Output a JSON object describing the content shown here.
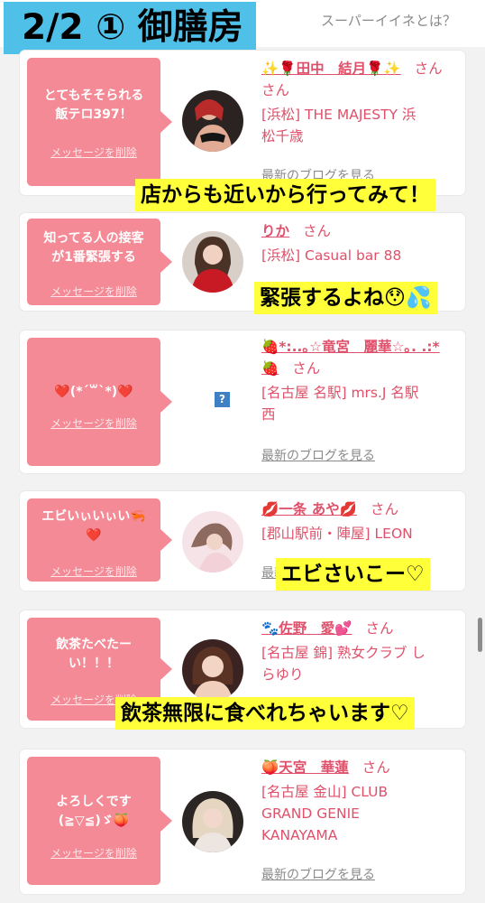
{
  "header": {
    "title": "2/2 ① 御膳房",
    "help_link": "スーパーイイネとは？"
  },
  "common": {
    "delete_label": "メッセージを削除",
    "blog_label": "最新のブログを見る",
    "san": "さん"
  },
  "cards": [
    {
      "message_lines": [
        "とてもそそられる",
        "飯テロ397！"
      ],
      "name_lines": [
        "✨🌹田中　結月🌹✨"
      ],
      "shop_lines": [
        "[浜松] THE MAJESTY 浜",
        "松千歳"
      ],
      "avatar_icon": "woman-photo-icon"
    },
    {
      "message_lines": [
        "知ってる人の接客",
        "が1番緊張する"
      ],
      "name_lines": [
        "りか"
      ],
      "shop_lines": [
        "[浜松] Casual bar 88"
      ],
      "avatar_icon": "woman-photo-icon"
    },
    {
      "message_lines": [
        "❤️(*´꒳`*)❤️"
      ],
      "name_lines": [
        "🍓*:..｡☆竜宮　麗華☆｡. .:*",
        "🍓"
      ],
      "shop_lines": [
        "[名古屋 名駅] mrs.J 名駅",
        "西"
      ],
      "avatar_icon": "broken-image-icon"
    },
    {
      "message_lines": [
        "エビいぃいぃい🦐",
        "❤️"
      ],
      "name_lines": [
        "💋一条 あや💋"
      ],
      "shop_lines": [
        "[郡山駅前・陣屋] LEON"
      ],
      "avatar_icon": "woman-photo-icon"
    },
    {
      "message_lines": [
        "飲茶たべたー",
        "い！！！"
      ],
      "name_lines": [
        "🐾佐野　愛💕"
      ],
      "shop_lines": [
        "[名古屋 錦] 熟女クラブ し",
        "らゆり"
      ],
      "avatar_icon": "woman-photo-icon"
    },
    {
      "message_lines": [
        "よろしくです",
        "(≧▽≦)ゞ🍑"
      ],
      "name_lines": [
        "🍑天宮　華蓮"
      ],
      "shop_lines": [
        "[名古屋 金山] CLUB",
        "GRAND GENIE",
        "KANAYAMA"
      ],
      "avatar_icon": "woman-photo-icon"
    }
  ],
  "overlays": {
    "caption_1": "店からも近いから行ってみて！",
    "caption_2": "緊張するよね😯💦",
    "caption_3": "エビさいこー♡",
    "caption_4": "飲茶無限に食べれちゃいます♡"
  },
  "colors": {
    "accent_pink": "#f48a96",
    "name_pink": "#e0506a",
    "title_blue": "#4fc1e9",
    "highlight_yellow": "#ffff3a"
  }
}
